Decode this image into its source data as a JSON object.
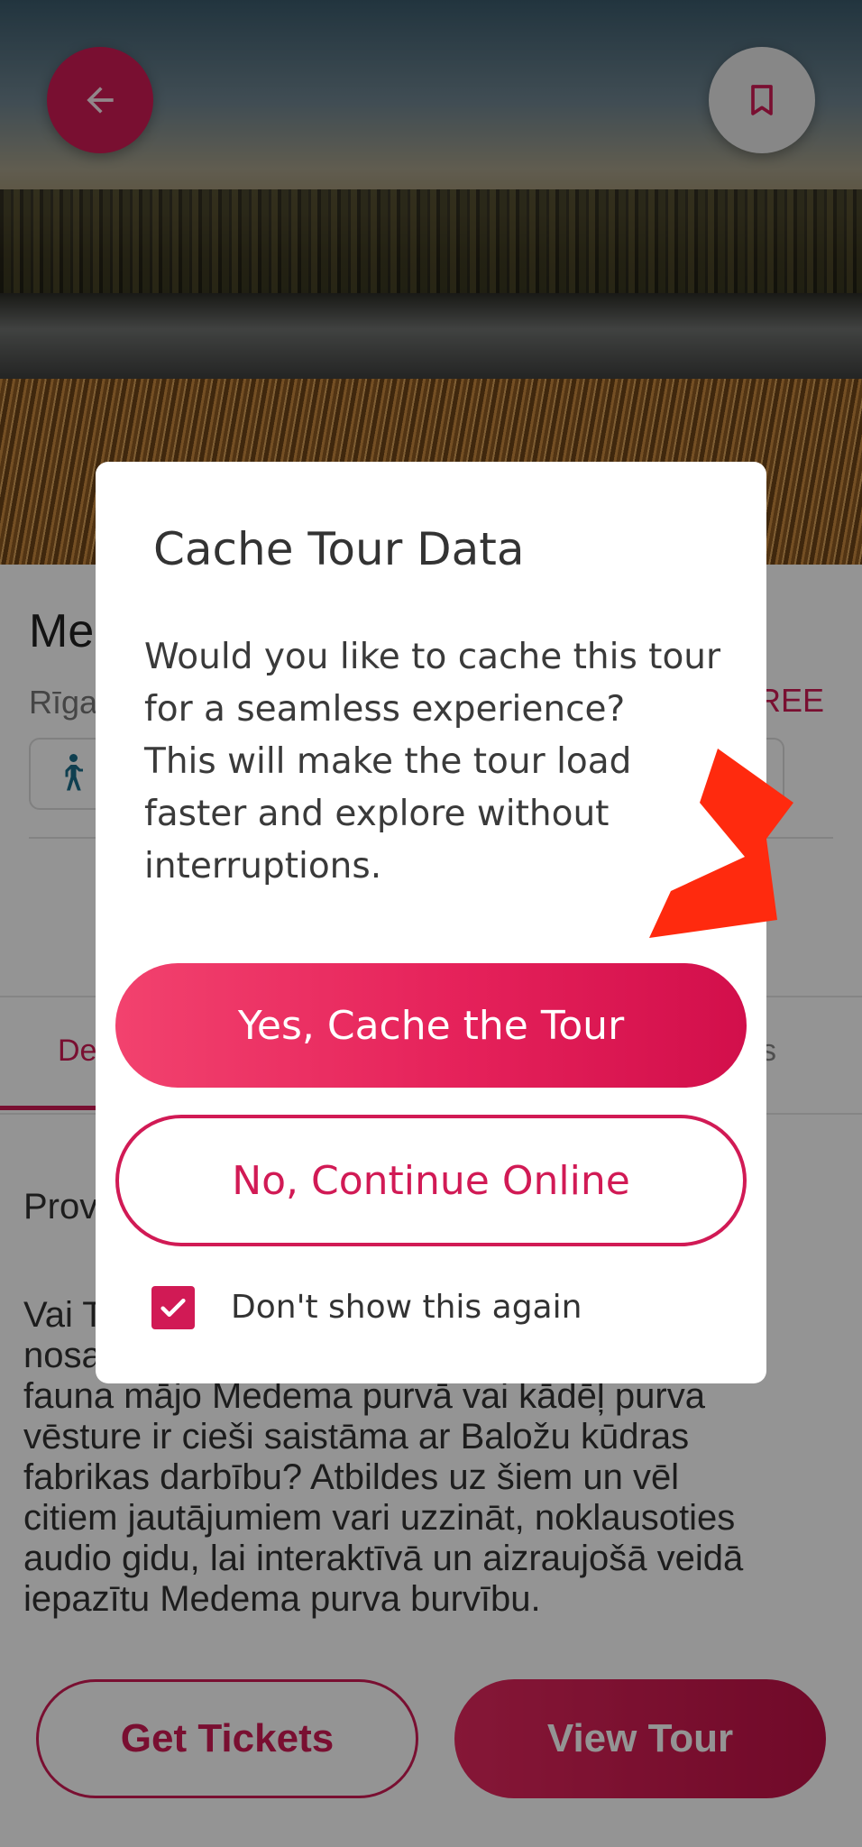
{
  "hero": {
    "back_icon": "arrow-left-icon",
    "bookmark_icon": "bookmark-icon"
  },
  "tour": {
    "title_partial": "Me",
    "subtitle_partial": "Rīga",
    "price_partial": "REE",
    "activity_icon": "walking-person-icon"
  },
  "tabs": {
    "active_partial": "De",
    "right_partial": "s"
  },
  "section": {
    "heading_partial": "Prov"
  },
  "description": {
    "lines": [
      "Vai T",
      "nosa",
      "fauna mājo Medema purvā vai kādēļ purva",
      "vēsture ir cieši saistāma ar Baložu kūdras",
      "fabrikas darbību? Atbildes uz šiem un vēl",
      "citiem jautājumiem vari uzzināt, noklausoties",
      "audio gidu, lai interaktīvā un aizraujošā veidā",
      "iepazītu Medema purva burvību."
    ]
  },
  "bottom": {
    "get_tickets": "Get Tickets",
    "view_tour": "View Tour"
  },
  "dialog": {
    "title": "Cache Tour Data",
    "body_lines": [
      "Would you like to cache this tour",
      "for a seamless experience?",
      "This will make the tour load",
      "faster and explore without",
      "interruptions."
    ],
    "yes_label": "Yes, Cache the Tour",
    "no_label": "No, Continue Online",
    "checkbox_label": "Don't show this again",
    "checkbox_checked": true
  },
  "colors": {
    "accent": "#d11a55",
    "annotation_arrow": "#ff2a0e"
  }
}
